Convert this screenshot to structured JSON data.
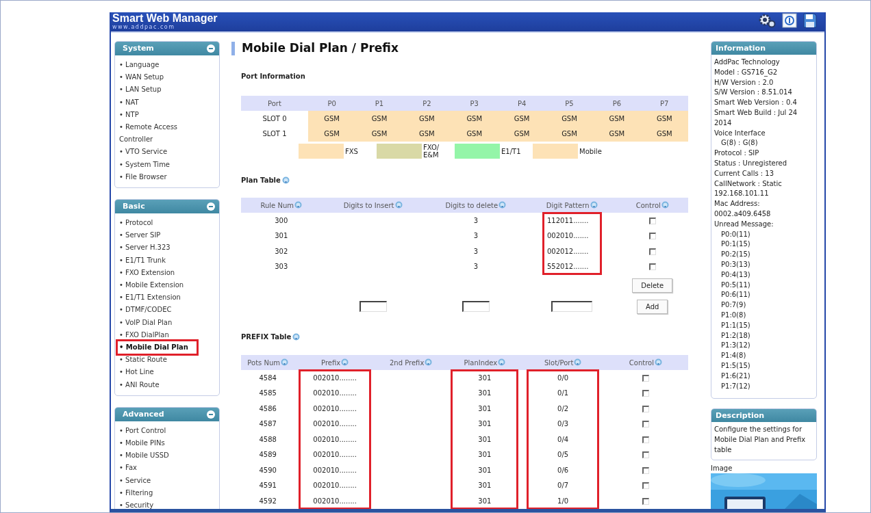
{
  "header": {
    "title": "Smart Web Manager",
    "subtitle": "www.addpac.com"
  },
  "sidebar": [
    {
      "title": "System",
      "expanded": true,
      "items": [
        {
          "label": "• Language",
          "selected": false,
          "highlighted": false
        },
        {
          "label": "• WAN Setup",
          "selected": false,
          "highlighted": false
        },
        {
          "label": "• LAN Setup",
          "selected": false,
          "highlighted": false
        },
        {
          "label": "• NAT",
          "selected": false,
          "highlighted": false
        },
        {
          "label": "• NTP",
          "selected": false,
          "highlighted": false
        },
        {
          "label": "• Remote Access Controller",
          "selected": false,
          "highlighted": false
        },
        {
          "label": "• VTO Service",
          "selected": false,
          "highlighted": false
        },
        {
          "label": "• System Time",
          "selected": false,
          "highlighted": false
        },
        {
          "label": "• File Browser",
          "selected": false,
          "highlighted": false
        }
      ]
    },
    {
      "title": "Basic",
      "expanded": true,
      "items": [
        {
          "label": "• Protocol",
          "selected": false,
          "highlighted": false
        },
        {
          "label": "• Server SIP",
          "selected": false,
          "highlighted": false
        },
        {
          "label": "• Server H.323",
          "selected": false,
          "highlighted": false
        },
        {
          "label": "• E1/T1 Trunk",
          "selected": false,
          "highlighted": false
        },
        {
          "label": "• FXO Extension",
          "selected": false,
          "highlighted": false
        },
        {
          "label": "• Mobile Extension",
          "selected": false,
          "highlighted": false
        },
        {
          "label": "• E1/T1 Extension",
          "selected": false,
          "highlighted": false
        },
        {
          "label": "• DTMF/CODEC",
          "selected": false,
          "highlighted": false
        },
        {
          "label": "• VoIP Dial Plan",
          "selected": false,
          "highlighted": false
        },
        {
          "label": "• FXO DialPlan",
          "selected": false,
          "highlighted": false
        },
        {
          "label": "• Mobile Dial Plan",
          "selected": true,
          "highlighted": true
        },
        {
          "label": "• Static Route",
          "selected": false,
          "highlighted": false
        },
        {
          "label": "• Hot Line",
          "selected": false,
          "highlighted": false
        },
        {
          "label": "• ANI Route",
          "selected": false,
          "highlighted": false
        }
      ]
    },
    {
      "title": "Advanced",
      "expanded": true,
      "items": [
        {
          "label": "• Port Control",
          "selected": false,
          "highlighted": false
        },
        {
          "label": "• Mobile PINs",
          "selected": false,
          "highlighted": false
        },
        {
          "label": "• Mobile USSD",
          "selected": false,
          "highlighted": false
        },
        {
          "label": "• Fax",
          "selected": false,
          "highlighted": false
        },
        {
          "label": "• Service",
          "selected": false,
          "highlighted": false
        },
        {
          "label": "• Filtering",
          "selected": false,
          "highlighted": false
        },
        {
          "label": "• Security",
          "selected": false,
          "highlighted": false
        }
      ]
    }
  ],
  "page_title": "Mobile Dial Plan / Prefix",
  "port_info": {
    "title": "Port Information",
    "header": [
      "Port",
      "P0",
      "P1",
      "P2",
      "P3",
      "P4",
      "P5",
      "P6",
      "P7"
    ],
    "slots": [
      {
        "label": "SLOT 0",
        "color": "#fde2b6",
        "ports": [
          "GSM",
          "GSM",
          "GSM",
          "GSM",
          "GSM",
          "GSM",
          "GSM",
          "GSM"
        ]
      },
      {
        "label": "SLOT 1",
        "color": "#fde2b6",
        "ports": [
          "GSM",
          "GSM",
          "GSM",
          "GSM",
          "GSM",
          "GSM",
          "GSM",
          "GSM"
        ]
      }
    ],
    "legend": [
      {
        "label": "FXS",
        "color": "#fde2b6"
      },
      {
        "label": "FXO/ E&M",
        "color": "#d9d9a6"
      },
      {
        "label": "E1/T1",
        "color": "#94f5a8"
      },
      {
        "label": "Mobile",
        "color": "#fde2b6"
      }
    ]
  },
  "plan_table": {
    "title": "Plan Table",
    "columns": [
      {
        "label": "Rule Num",
        "highlighted": false
      },
      {
        "label": "Digits to Insert",
        "highlighted": false
      },
      {
        "label": "Digits to delete",
        "highlighted": false
      },
      {
        "label": "Digit Pattern",
        "highlighted": true
      },
      {
        "label": "Control",
        "highlighted": false
      }
    ],
    "rows": [
      {
        "rule_num": "300",
        "digits_to_delete": "3",
        "digit_pattern": "112011.......",
        "checked": false
      },
      {
        "rule_num": "301",
        "digits_to_delete": "3",
        "digit_pattern": "002010.......",
        "checked": false
      },
      {
        "rule_num": "302",
        "digits_to_delete": "3",
        "digit_pattern": "002012.......",
        "checked": false
      },
      {
        "rule_num": "303",
        "digits_to_delete": "3",
        "digit_pattern": "552012.......",
        "checked": false
      }
    ],
    "delete_button": "Delete",
    "add_button": "Add"
  },
  "prefix_table": {
    "title": "PREFIX Table",
    "columns": [
      {
        "label": "Pots Num",
        "highlighted": false
      },
      {
        "label": "Prefix",
        "highlighted": true
      },
      {
        "label": "2nd Prefix",
        "highlighted": false
      },
      {
        "label": "PlanIndex",
        "highlighted": true
      },
      {
        "label": "Slot/Port",
        "highlighted": true
      },
      {
        "label": "Control",
        "highlighted": false
      }
    ],
    "rows": [
      {
        "pots_num": "4584",
        "prefix": "002010........",
        "plan_index": "301",
        "slot_port": "0/0",
        "checked": false
      },
      {
        "pots_num": "4585",
        "prefix": "002010........",
        "plan_index": "301",
        "slot_port": "0/1",
        "checked": false
      },
      {
        "pots_num": "4586",
        "prefix": "002010........",
        "plan_index": "301",
        "slot_port": "0/2",
        "checked": false
      },
      {
        "pots_num": "4587",
        "prefix": "002010........",
        "plan_index": "301",
        "slot_port": "0/3",
        "checked": false
      },
      {
        "pots_num": "4588",
        "prefix": "002010........",
        "plan_index": "301",
        "slot_port": "0/4",
        "checked": false
      },
      {
        "pots_num": "4589",
        "prefix": "002010........",
        "plan_index": "301",
        "slot_port": "0/5",
        "checked": false
      },
      {
        "pots_num": "4590",
        "prefix": "002010........",
        "plan_index": "301",
        "slot_port": "0/6",
        "checked": false
      },
      {
        "pots_num": "4591",
        "prefix": "002010........",
        "plan_index": "301",
        "slot_port": "0/7",
        "checked": false
      },
      {
        "pots_num": "4592",
        "prefix": "002010........",
        "plan_index": "301",
        "slot_port": "1/0",
        "checked": false
      }
    ]
  },
  "information": {
    "title": "Information",
    "lines": [
      {
        "text": "AddPac Technology"
      },
      {
        "text": "Model : GS716_G2"
      },
      {
        "text": "H/W Version : 2.0"
      },
      {
        "text": "S/W Version : 8.51.014"
      },
      {
        "text": "Smart Web Version : 0.4"
      },
      {
        "text": "Smart Web Build : Jul 24 2014"
      },
      {
        "text": "Voice Interface",
        "children": [
          {
            "text": "G(8) : G(8)"
          }
        ]
      },
      {
        "text": "Protocol : SIP"
      },
      {
        "text": "Status : Unregistered"
      },
      {
        "text": "Current Calls : 13"
      },
      {
        "text": "CallNetwork : Static 192.168.101.11"
      },
      {
        "text": "Mac Address: 0002.a409.6458"
      },
      {
        "text": "Unread Message:",
        "children": [
          {
            "text": "P0:0(11)"
          },
          {
            "text": "P0:1(15)"
          },
          {
            "text": "P0:2(15)"
          },
          {
            "text": "P0:3(13)"
          },
          {
            "text": "P0:4(13)"
          },
          {
            "text": "P0:5(11)"
          },
          {
            "text": "P0:6(11)"
          },
          {
            "text": "P0:7(9)"
          },
          {
            "text": "P1:0(8)"
          },
          {
            "text": "P1:1(15)"
          },
          {
            "text": "P1:2(18)"
          },
          {
            "text": "P1:3(12)"
          },
          {
            "text": "P1:4(8)"
          },
          {
            "text": "P1:5(15)"
          },
          {
            "text": "P1:6(21)"
          },
          {
            "text": "P1:7(12)"
          }
        ]
      }
    ]
  },
  "description": {
    "title": "Description",
    "text": "Configure the settings for Mobile Dial Plan and Prefix table"
  },
  "image": {
    "label": "Image",
    "kind": "picture"
  }
}
